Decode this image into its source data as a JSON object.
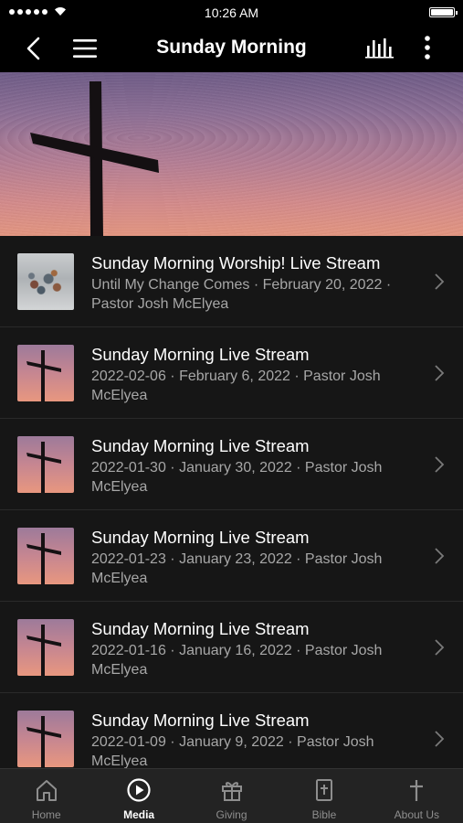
{
  "status_bar": {
    "time": "10:26 AM"
  },
  "nav": {
    "title": "Sunday Morning"
  },
  "media_items": [
    {
      "title": "Sunday Morning Worship! Live Stream",
      "subtitle": "Until My Change Comes · February 20, 2022 · Pastor Josh McElyea",
      "thumbnail": "stones-photo"
    },
    {
      "title": "Sunday Morning Live Stream",
      "subtitle": "2022-02-06 · February 6, 2022 · Pastor Josh McElyea",
      "thumbnail": "cross-sunset"
    },
    {
      "title": "Sunday Morning Live Stream",
      "subtitle": "2022-01-30 · January 30, 2022 · Pastor Josh McElyea",
      "thumbnail": "cross-sunset"
    },
    {
      "title": "Sunday Morning Live Stream",
      "subtitle": "2022-01-23 · January 23, 2022 · Pastor Josh McElyea",
      "thumbnail": "cross-sunset"
    },
    {
      "title": "Sunday Morning Live Stream",
      "subtitle": "2022-01-16 · January 16, 2022 · Pastor Josh McElyea",
      "thumbnail": "cross-sunset"
    },
    {
      "title": "Sunday Morning Live Stream",
      "subtitle": "2022-01-09 · January 9, 2022 · Pastor Josh McElyea",
      "thumbnail": "cross-sunset"
    }
  ],
  "tabs": [
    {
      "label": "Home",
      "icon": "home-icon",
      "active": false
    },
    {
      "label": "Media",
      "icon": "play-circle-icon",
      "active": true
    },
    {
      "label": "Giving",
      "icon": "gift-icon",
      "active": false
    },
    {
      "label": "Bible",
      "icon": "bible-icon",
      "active": false
    },
    {
      "label": "About Us",
      "icon": "cross-icon",
      "active": false
    }
  ],
  "colors": {
    "background": "#161616",
    "bar": "#000000",
    "tab_bar": "#232323",
    "subtitle_text": "#a7a7a7",
    "inactive_tab": "#8e8e8e"
  }
}
